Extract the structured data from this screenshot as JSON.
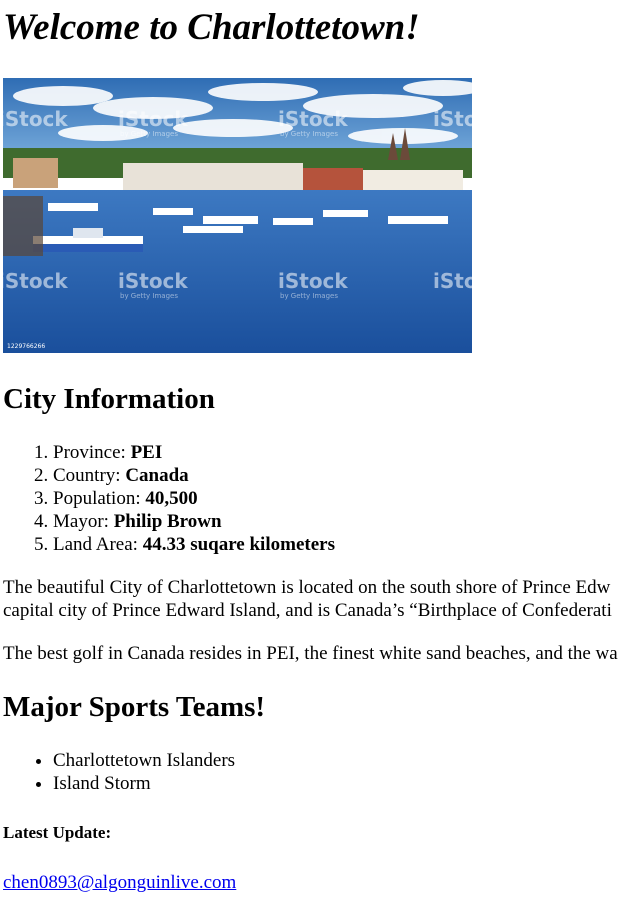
{
  "page_title": "Welcome to Charlottetown!",
  "hero_image": {
    "watermark_text": "iStock",
    "watermark_sub": "by Getty Images",
    "image_id": "1229766266"
  },
  "city_info": {
    "heading": "City Information",
    "items": [
      {
        "label": "Province: ",
        "value": "PEI"
      },
      {
        "label": "Country: ",
        "value": "Canada"
      },
      {
        "label": "Population: ",
        "value": "40,500"
      },
      {
        "label": "Mayor: ",
        "value": "Philip Brown"
      },
      {
        "label": "Land Area: ",
        "value": "44.33 suqare kilometers"
      }
    ]
  },
  "paragraphs": {
    "intro_line1": "The beautiful City of Charlottetown is located on the south shore of Prince Edw",
    "intro_line2": "capital city of Prince Edward Island, and is Canada’s “Birthplace of Confederati",
    "golf": "The best golf in Canada resides in PEI, the finest white sand beaches, and the wa"
  },
  "sports": {
    "heading": "Major Sports Teams!",
    "teams": [
      "Charlottetown Islanders",
      "Island Storm"
    ]
  },
  "latest_update": {
    "label": "Latest Update:"
  },
  "contact": {
    "email": "chen0893@algonguinlive.com"
  },
  "colors": {
    "link": "#0000ee",
    "sky": "#3a7cc0",
    "water": "#1f5fae"
  }
}
